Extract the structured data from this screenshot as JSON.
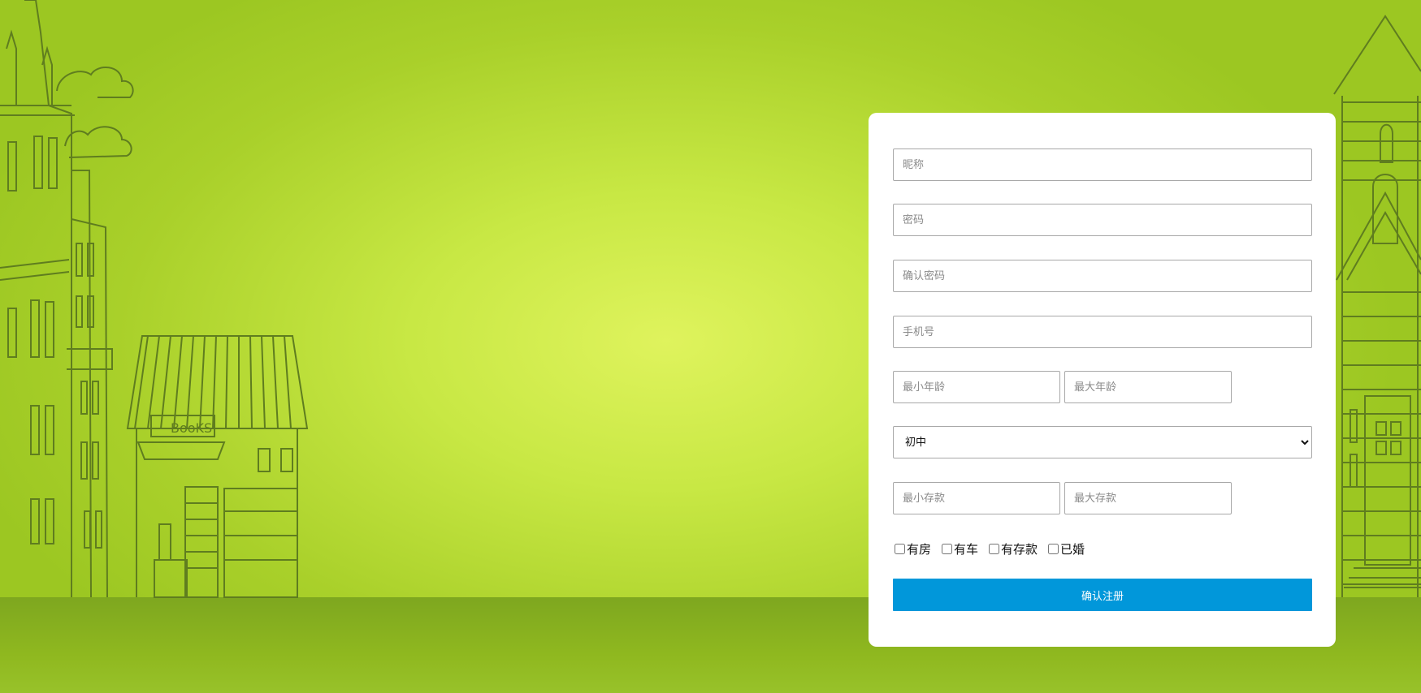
{
  "form": {
    "nickname_placeholder": "昵称",
    "password_placeholder": "密码",
    "confirm_password_placeholder": "确认密码",
    "phone_placeholder": "手机号",
    "min_age_placeholder": "最小年龄",
    "max_age_placeholder": "最大年龄",
    "education_select": {
      "selected": "初中"
    },
    "min_savings_placeholder": "最小存款",
    "max_savings_placeholder": "最大存款",
    "checkboxes": [
      {
        "label": "有房",
        "checked": false
      },
      {
        "label": "有车",
        "checked": false
      },
      {
        "label": "有存款",
        "checked": false
      },
      {
        "label": "已婚",
        "checked": false
      }
    ],
    "submit_label": "确认注册"
  },
  "background": {
    "book_sign": "BooKS",
    "colors": {
      "sky_center": "#dff35d",
      "sky_edge": "#9cc722",
      "ground": "#7ea71f",
      "line_art": "#5f7d1f",
      "button": "#0197da"
    }
  }
}
